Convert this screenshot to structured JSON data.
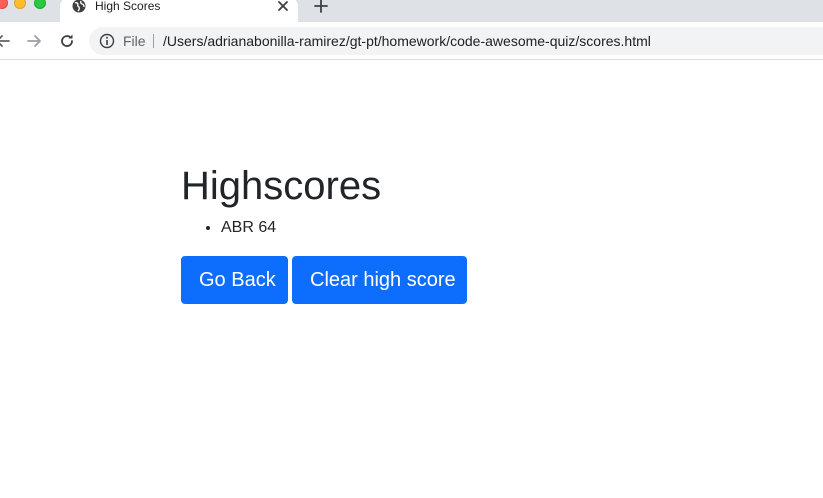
{
  "browser": {
    "tab": {
      "title": "High Scores",
      "icon": "globe-icon"
    },
    "address_bar": {
      "scheme_label": "File",
      "url": "/Users/adrianabonilla-ramirez/gt-pt/homework/code-awesome-quiz/scores.html"
    }
  },
  "page": {
    "heading": "Highscores",
    "scores": [
      "ABR 64"
    ],
    "buttons": {
      "go_back": "Go Back",
      "clear": "Clear high score"
    }
  },
  "colors": {
    "primary_button": "#0d6efd",
    "text": "#212529"
  }
}
